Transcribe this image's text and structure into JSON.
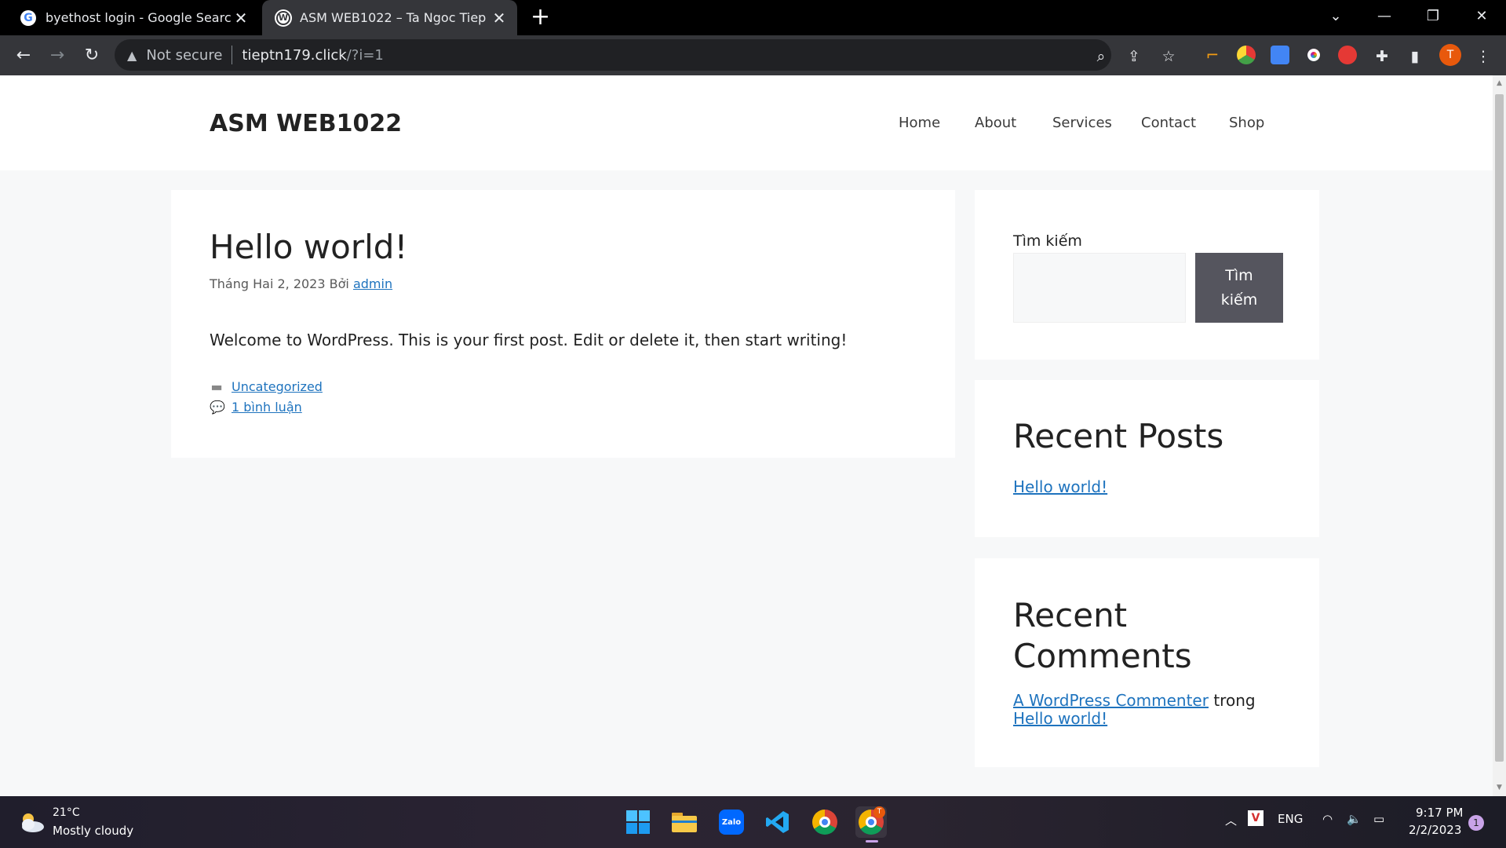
{
  "browser": {
    "tabs": [
      {
        "title": "byethost login - Google Search",
        "favicon": "google-icon"
      },
      {
        "title": "ASM WEB1022 – Ta Ngoc Tiep",
        "favicon": "wordpress-icon"
      }
    ],
    "address": {
      "security": "Not secure",
      "host": "tieptn179.click",
      "path": "/?i=1"
    },
    "profile_initial": "T"
  },
  "site": {
    "title": "ASM WEB1022",
    "nav": [
      "Home",
      "About",
      "Services",
      "Contact",
      "Shop"
    ],
    "post": {
      "title": "Hello world!",
      "date": "Tháng Hai 2, 2023",
      "by": "Bởi",
      "author": "admin",
      "content": "Welcome to WordPress. This is your first post. Edit or delete it, then start writing!",
      "category": "Uncategorized",
      "comments": "1 bình luận"
    },
    "sidebar": {
      "search_label": "Tìm kiếm",
      "search_button": "Tìm kiếm",
      "recent_posts_title": "Recent Posts",
      "recent_posts": [
        "Hello world!"
      ],
      "recent_comments_title": "Recent Comments",
      "comment_author": "A WordPress Commenter",
      "comment_on": "trong",
      "comment_post": "Hello world!"
    }
  },
  "taskbar": {
    "weather_temp": "21°C",
    "weather_desc": "Mostly cloudy",
    "language": "ENG",
    "time": "9:17 PM",
    "date": "2/2/2023",
    "notifications": "1",
    "chrome_badge": "T"
  },
  "colors": {
    "link": "#1e73be",
    "button": "#55555e",
    "page_bg": "#f7f8f9"
  }
}
